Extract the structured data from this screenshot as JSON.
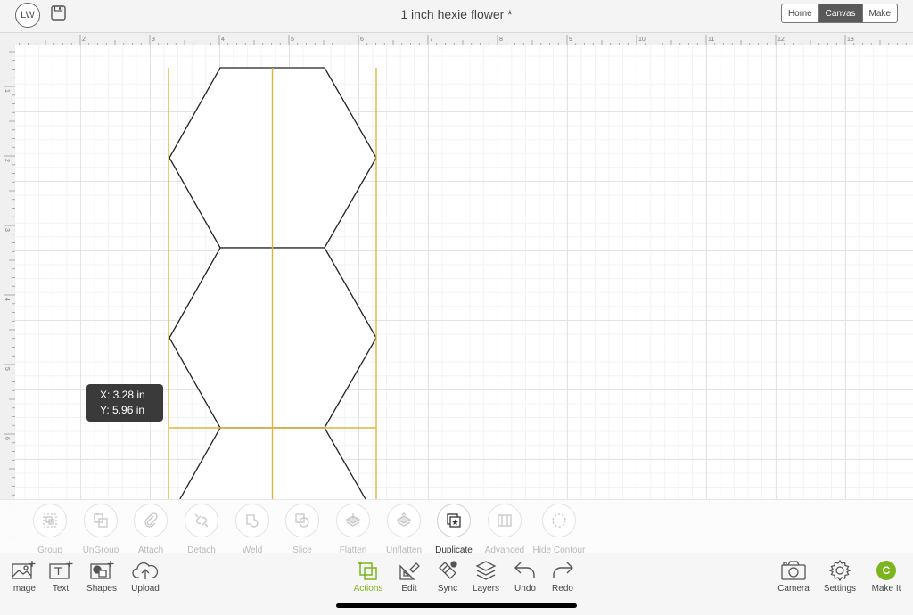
{
  "header": {
    "avatar_initials": "LW",
    "document_title": "1 inch hexie flower *",
    "mode_tabs": [
      {
        "label": "Home",
        "active": false
      },
      {
        "label": "Canvas",
        "active": true
      },
      {
        "label": "Make",
        "active": false
      }
    ]
  },
  "rulers": {
    "top": [
      "2",
      "3",
      "4",
      "5",
      "6",
      "7",
      "8",
      "9",
      "10",
      "11",
      "12",
      "13"
    ],
    "left": [
      "1",
      "2",
      "3",
      "4",
      "5",
      "6",
      "7"
    ]
  },
  "coordinates": {
    "x": "X: 3.28 in",
    "y": "Y: 5.96 in"
  },
  "actions": [
    {
      "label": "Group",
      "icon": "group-icon",
      "enabled": false
    },
    {
      "label": "UnGroup",
      "icon": "ungroup-icon",
      "enabled": false
    },
    {
      "label": "Attach",
      "icon": "attach-icon",
      "enabled": false
    },
    {
      "label": "Detach",
      "icon": "detach-icon",
      "enabled": false
    },
    {
      "label": "Weld",
      "icon": "weld-icon",
      "enabled": false
    },
    {
      "label": "Slice",
      "icon": "slice-icon",
      "enabled": false
    },
    {
      "label": "Flatten",
      "icon": "flatten-icon",
      "enabled": false
    },
    {
      "label": "Unflatten",
      "icon": "unflatten-icon",
      "enabled": false
    },
    {
      "label": "Duplicate",
      "icon": "duplicate-icon",
      "enabled": true
    },
    {
      "label": "Advanced",
      "icon": "advanced-icon",
      "enabled": false
    },
    {
      "label": "Hide Contour",
      "icon": "hide-contour-icon",
      "enabled": false
    }
  ],
  "toolbar": {
    "left": [
      {
        "label": "Image",
        "icon": "image-add-icon"
      },
      {
        "label": "Text",
        "icon": "text-add-icon"
      },
      {
        "label": "Shapes",
        "icon": "shapes-add-icon"
      },
      {
        "label": "Upload",
        "icon": "upload-cloud-icon"
      }
    ],
    "center": [
      {
        "label": "Actions",
        "icon": "actions-icon",
        "active": true
      },
      {
        "label": "Edit",
        "icon": "edit-icon",
        "active": false
      },
      {
        "label": "Sync",
        "icon": "sync-icon",
        "active": false
      },
      {
        "label": "Layers",
        "icon": "layers-icon",
        "active": false
      },
      {
        "label": "Undo",
        "icon": "undo-icon",
        "active": false
      },
      {
        "label": "Redo",
        "icon": "redo-icon",
        "active": false
      }
    ],
    "right": [
      {
        "label": "Camera",
        "icon": "camera-icon"
      },
      {
        "label": "Settings",
        "icon": "gear-icon"
      },
      {
        "label": "Make It",
        "icon": "make-it-icon",
        "badge": "C"
      }
    ]
  },
  "colors": {
    "accent_green": "#7cb51d",
    "guide_gold": "#e0b43c",
    "active_tab": "#595959"
  }
}
